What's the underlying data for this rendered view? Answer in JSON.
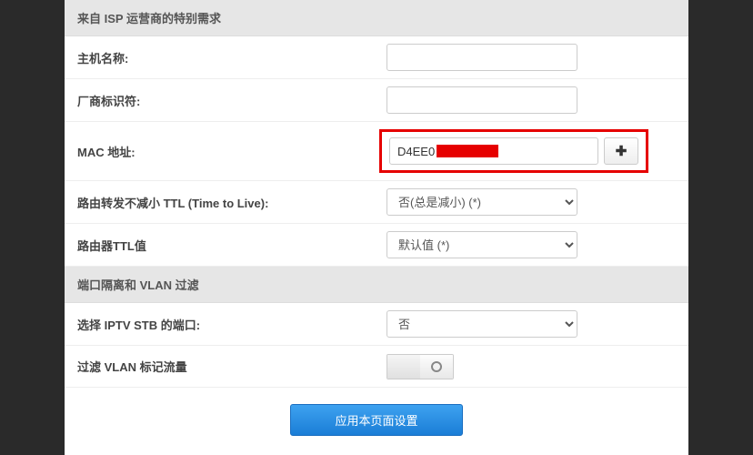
{
  "sections": {
    "isp": {
      "title": "来自 ISP 运营商的特别需求",
      "hostname_label": "主机名称:",
      "hostname_value": "",
      "vendor_label": "厂商标识符:",
      "vendor_value": "",
      "mac_label": "MAC 地址:",
      "mac_prefix": "D4EE0",
      "ttl_forward_label": "路由转发不减小 TTL (Time to Live):",
      "ttl_forward_select": "否(总是减小) (*)",
      "router_ttl_label": "路由器TTL值",
      "router_ttl_select": "默认值 (*)"
    },
    "vlan": {
      "title": "端口隔离和 VLAN 过滤",
      "iptv_label": "选择 IPTV STB 的端口:",
      "iptv_select": "否",
      "vlan_filter_label": "过滤 VLAN 标记流量"
    }
  },
  "actions": {
    "apply_label": "应用本页面设置"
  },
  "icons": {
    "plus": "✚"
  }
}
